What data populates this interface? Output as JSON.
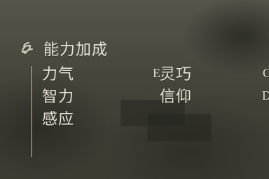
{
  "attribute_scaling": {
    "title": "能力加成",
    "icon": "scaling-emblem-icon",
    "stats": [
      {
        "key": "strength",
        "label": "力气",
        "grade": "E"
      },
      {
        "key": "dexterity",
        "label": "灵巧",
        "grade": "C"
      },
      {
        "key": "intelligence",
        "label": "智力",
        "grade": ""
      },
      {
        "key": "faith",
        "label": "信仰",
        "grade": "D"
      },
      {
        "key": "arcane",
        "label": "感应",
        "grade": ""
      }
    ]
  },
  "colors": {
    "text": "#e9e4d6",
    "rule": "#dcd7c6"
  }
}
